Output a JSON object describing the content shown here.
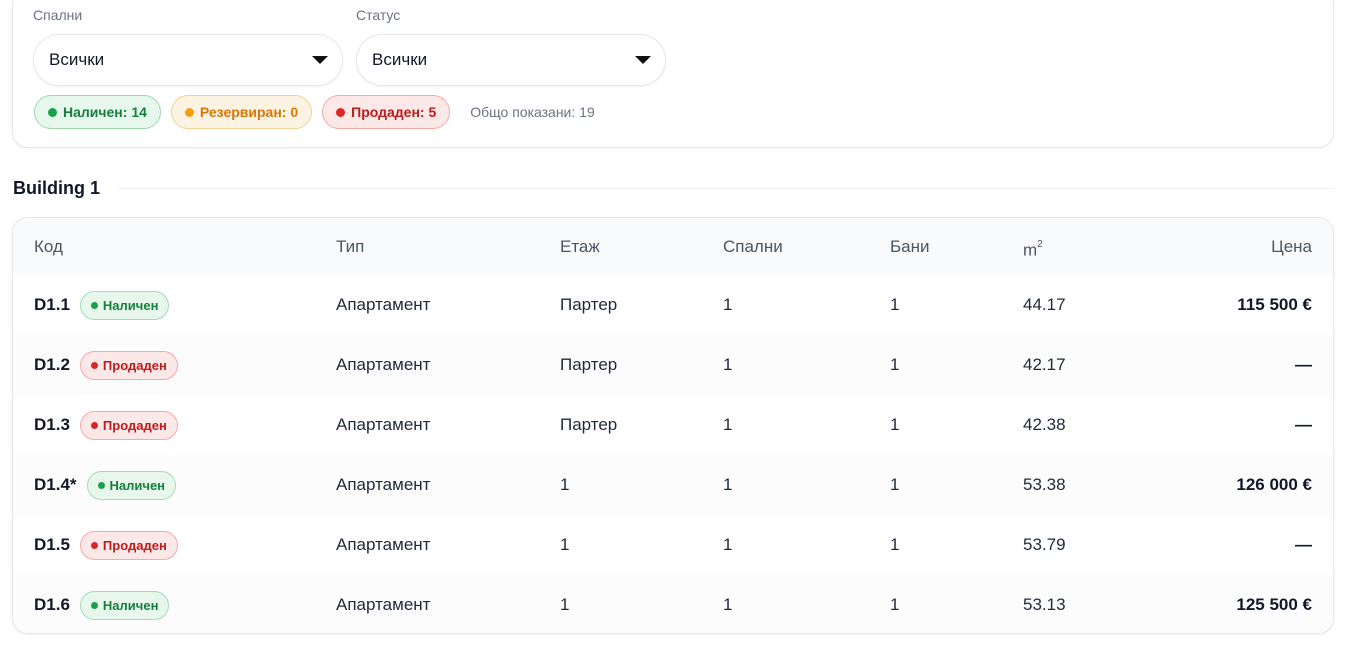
{
  "filters": {
    "bedrooms": {
      "label": "Спални",
      "value": "Всички"
    },
    "status": {
      "label": "Статус",
      "value": "Всички"
    }
  },
  "summary": {
    "available": "Наличен: 14",
    "reserved": "Резервиран: 0",
    "sold": "Продаден: 5",
    "total": "Общо показани: 19"
  },
  "section": {
    "title": "Building 1"
  },
  "table": {
    "headers": {
      "code": "Код",
      "type": "Тип",
      "floor": "Етаж",
      "bedrooms": "Спални",
      "bathrooms": "Бани",
      "area": "m",
      "area_sup": "2",
      "price": "Цена"
    },
    "rows": [
      {
        "code": "D1.1",
        "status": "Наличен",
        "status_kind": "available",
        "type": "Апартамент",
        "floor": "Партер",
        "bedrooms": "1",
        "bathrooms": "1",
        "area": "44.17",
        "price": "115 500 €"
      },
      {
        "code": "D1.2",
        "status": "Продаден",
        "status_kind": "sold",
        "type": "Апартамент",
        "floor": "Партер",
        "bedrooms": "1",
        "bathrooms": "1",
        "area": "42.17",
        "price": "—"
      },
      {
        "code": "D1.3",
        "status": "Продаден",
        "status_kind": "sold",
        "type": "Апартамент",
        "floor": "Партер",
        "bedrooms": "1",
        "bathrooms": "1",
        "area": "42.38",
        "price": "—"
      },
      {
        "code": "D1.4*",
        "status": "Наличен",
        "status_kind": "available",
        "type": "Апартамент",
        "floor": "1",
        "bedrooms": "1",
        "bathrooms": "1",
        "area": "53.38",
        "price": "126 000 €"
      },
      {
        "code": "D1.5",
        "status": "Продаден",
        "status_kind": "sold",
        "type": "Апартамент",
        "floor": "1",
        "bedrooms": "1",
        "bathrooms": "1",
        "area": "53.79",
        "price": "—"
      },
      {
        "code": "D1.6",
        "status": "Наличен",
        "status_kind": "available",
        "type": "Апартамент",
        "floor": "1",
        "bedrooms": "1",
        "bathrooms": "1",
        "area": "53.13",
        "price": "125 500 €"
      }
    ]
  },
  "colors": {
    "available": "#16a34a",
    "reserved": "#f59e0b",
    "sold": "#dc2626"
  }
}
